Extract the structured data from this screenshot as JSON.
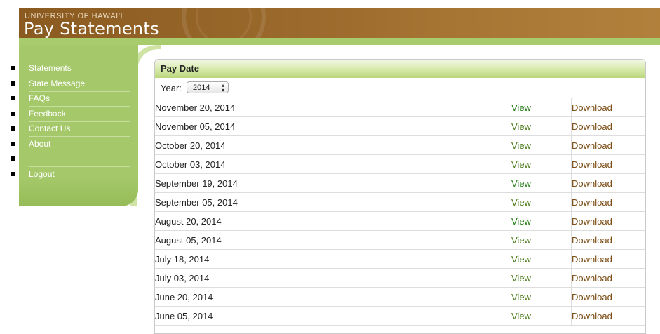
{
  "header": {
    "university": "UNIVERSITY OF HAWAI'I",
    "title": "Pay Statements"
  },
  "nav": {
    "items": [
      {
        "label": "Statements"
      },
      {
        "label": "State Message"
      },
      {
        "label": "FAQs"
      },
      {
        "label": "Feedback"
      },
      {
        "label": "Contact Us"
      },
      {
        "label": "About"
      },
      {
        "label": ""
      },
      {
        "label": "Logout"
      }
    ]
  },
  "panel": {
    "heading": "Pay Date",
    "year_label": "Year:",
    "year_value": "2014"
  },
  "statements": [
    {
      "date": "November 20, 2014",
      "view": "View",
      "download": "Download"
    },
    {
      "date": "November 05, 2014",
      "view": "View",
      "download": "Download"
    },
    {
      "date": "October 20, 2014",
      "view": "View",
      "download": "Download"
    },
    {
      "date": "October 03, 2014",
      "view": "View",
      "download": "Download"
    },
    {
      "date": "September 19, 2014",
      "view": "View",
      "download": "Download"
    },
    {
      "date": "September 05, 2014",
      "view": "View",
      "download": "Download"
    },
    {
      "date": "August 20, 2014",
      "view": "View",
      "download": "Download"
    },
    {
      "date": "August 05, 2014",
      "view": "View",
      "download": "Download"
    },
    {
      "date": "July 18, 2014",
      "view": "View",
      "download": "Download"
    },
    {
      "date": "July 03, 2014",
      "view": "View",
      "download": "Download"
    },
    {
      "date": "June 20, 2014",
      "view": "View",
      "download": "Download"
    },
    {
      "date": "June 05, 2014",
      "view": "View",
      "download": "Download"
    }
  ],
  "colors": {
    "header_brown": "#9b6a2c",
    "nav_green": "#a5c96a",
    "view_link": "#4a7a18",
    "download_link": "#7a4a10"
  }
}
